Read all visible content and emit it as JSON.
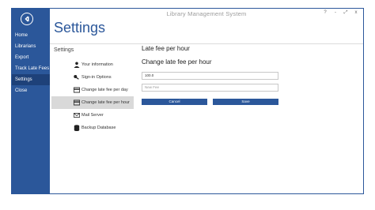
{
  "app": {
    "title": "Library Management System"
  },
  "window_controls": {
    "help": "?",
    "minimize": "-",
    "restore": "⤢",
    "close": "x"
  },
  "sidebar": {
    "items": [
      {
        "label": "Home",
        "active": false
      },
      {
        "label": "Librarians",
        "active": false
      },
      {
        "label": "Export",
        "active": false
      },
      {
        "label": "Track Late Fees",
        "active": false
      },
      {
        "label": "Settings",
        "active": true
      },
      {
        "label": "Close",
        "active": false
      }
    ]
  },
  "page": {
    "title": "Settings"
  },
  "settings_menu": {
    "heading": "Settings",
    "items": [
      {
        "label": "Your information",
        "icon": "user-icon"
      },
      {
        "label": "Sign-in Options",
        "icon": "key-icon"
      },
      {
        "label": "Change late fee per day",
        "icon": "card-icon"
      },
      {
        "label": "Change late fee per hour",
        "icon": "card-icon",
        "selected": true
      },
      {
        "label": "Mail Server",
        "icon": "mail-icon"
      },
      {
        "label": "Backup Database",
        "icon": "database-icon"
      }
    ]
  },
  "panel": {
    "title": "Late fee per hour",
    "subtitle": "Change late fee per hour",
    "current_value": "100.0",
    "new_fee_placeholder": "New Fee",
    "cancel_label": "Cancel",
    "save_label": "Save"
  },
  "colors": {
    "accent": "#2b579a",
    "selected_menu": "#d9d9d9"
  }
}
